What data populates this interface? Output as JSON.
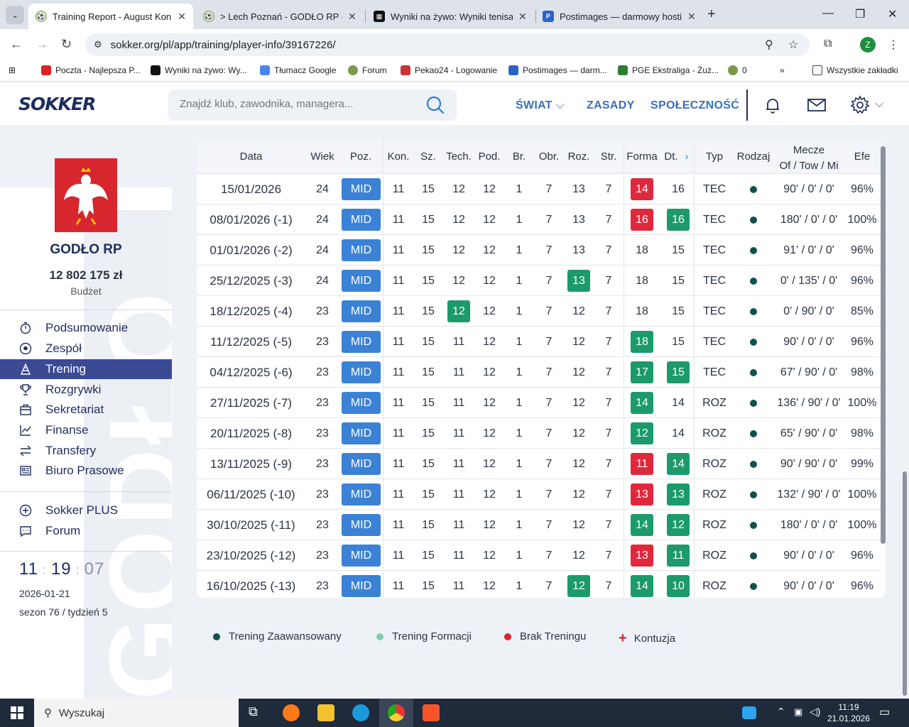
{
  "browser": {
    "tabs": [
      {
        "title": "Training Report - August Konkie",
        "active": true
      },
      {
        "title": "> Lech Poznań - GODŁO RP - S",
        "active": false
      },
      {
        "title": "Wyniki na żywo: Wyniki tenisa n",
        "active": false
      },
      {
        "title": "Postimages — darmowy hostin",
        "active": false
      }
    ],
    "url": "sokker.org/pl/app/training/player-info/39167226/",
    "profile_initial": "Z",
    "bookmarks": [
      "Poczta - Najlepsza P...",
      "Wyniki na żywo: Wy...",
      "Tłumacz Google",
      "Forum",
      "Pekao24 - Logowanie",
      "Postimages — darm...",
      "PGE Ekstraliga - Żuż...",
      "0"
    ],
    "all_bookmarks": "Wszystkie zakładki"
  },
  "header": {
    "logo": "SOKKER",
    "search_placeholder": "Znajdź klub, zawodnika, managera...",
    "nav": [
      "ŚWIAT",
      "ZASADY",
      "SPOŁECZNOŚĆ"
    ]
  },
  "sidebar": {
    "watermark": "GODŁO",
    "club_name": "GODŁO RP",
    "budget": "12 802 175 zł",
    "budget_label": "Budżet",
    "menu": [
      {
        "label": "Podsumowanie",
        "icon": "stopwatch-icon"
      },
      {
        "label": "Zespół",
        "icon": "ball-icon"
      },
      {
        "label": "Trening",
        "icon": "cone-icon"
      },
      {
        "label": "Rozgrywki",
        "icon": "trophy-icon"
      },
      {
        "label": "Sekretariat",
        "icon": "briefcase-icon"
      },
      {
        "label": "Finanse",
        "icon": "chart-icon"
      },
      {
        "label": "Transfery",
        "icon": "transfer-icon"
      },
      {
        "label": "Biuro Prasowe",
        "icon": "newspaper-icon"
      }
    ],
    "extra_menu": [
      {
        "label": "Sokker PLUS",
        "icon": "plus-circle-icon"
      },
      {
        "label": "Forum",
        "icon": "chat-icon"
      }
    ],
    "clock": {
      "h": "11",
      "m": "19",
      "s": "07"
    },
    "date": "2026-01-21",
    "season": "sezon 76 / tydzień 5"
  },
  "table": {
    "headers": {
      "date": "Data",
      "age": "Wiek",
      "pos": "Poz.",
      "kon": "Kon.",
      "sz": "Sz.",
      "tech": "Tech.",
      "pod": "Pod.",
      "br": "Br.",
      "obr": "Obr.",
      "roz": "Roz.",
      "str": "Str.",
      "forma": "Forma",
      "dt": "Dt.",
      "typ": "Typ",
      "rodzaj": "Rodzaj",
      "mecze_1": "Mecze",
      "mecze_2": "Of / Tow / Mi",
      "efe": "Efe"
    },
    "rows": [
      {
        "date": "15/01/2026",
        "age": "24",
        "pos": "MID",
        "kon": "11",
        "sz": "15",
        "tech": "12",
        "pod": "12",
        "br": "1",
        "obr": "7",
        "roz": "13",
        "str": "7",
        "forma": "14",
        "dt": "16",
        "typ": "TEC",
        "mecze": "90' / 0' / 0'",
        "efe": "96%",
        "hl": {
          "forma": "down"
        }
      },
      {
        "date": "08/01/2026 (-1)",
        "age": "24",
        "pos": "MID",
        "kon": "11",
        "sz": "15",
        "tech": "12",
        "pod": "12",
        "br": "1",
        "obr": "7",
        "roz": "13",
        "str": "7",
        "forma": "16",
        "dt": "16",
        "typ": "TEC",
        "mecze": "180' / 0' / 0'",
        "efe": "100%",
        "hl": {
          "forma": "down",
          "dt": "up"
        }
      },
      {
        "date": "01/01/2026 (-2)",
        "age": "24",
        "pos": "MID",
        "kon": "11",
        "sz": "15",
        "tech": "12",
        "pod": "12",
        "br": "1",
        "obr": "7",
        "roz": "13",
        "str": "7",
        "forma": "18",
        "dt": "15",
        "typ": "TEC",
        "mecze": "91' / 0' / 0'",
        "efe": "96%",
        "hl": {}
      },
      {
        "date": "25/12/2025 (-3)",
        "age": "24",
        "pos": "MID",
        "kon": "11",
        "sz": "15",
        "tech": "12",
        "pod": "12",
        "br": "1",
        "obr": "7",
        "roz": "13",
        "str": "7",
        "forma": "18",
        "dt": "15",
        "typ": "TEC",
        "mecze": "0' / 135' / 0'",
        "efe": "96%",
        "hl": {
          "roz": "up"
        }
      },
      {
        "date": "18/12/2025 (-4)",
        "age": "23",
        "pos": "MID",
        "kon": "11",
        "sz": "15",
        "tech": "12",
        "pod": "12",
        "br": "1",
        "obr": "7",
        "roz": "12",
        "str": "7",
        "forma": "18",
        "dt": "15",
        "typ": "TEC",
        "mecze": "0' / 90' / 0'",
        "efe": "85%",
        "hl": {
          "tech": "up"
        }
      },
      {
        "date": "11/12/2025 (-5)",
        "age": "23",
        "pos": "MID",
        "kon": "11",
        "sz": "15",
        "tech": "11",
        "pod": "12",
        "br": "1",
        "obr": "7",
        "roz": "12",
        "str": "7",
        "forma": "18",
        "dt": "15",
        "typ": "TEC",
        "mecze": "90' / 0' / 0'",
        "efe": "96%",
        "hl": {
          "forma": "up"
        }
      },
      {
        "date": "04/12/2025 (-6)",
        "age": "23",
        "pos": "MID",
        "kon": "11",
        "sz": "15",
        "tech": "11",
        "pod": "12",
        "br": "1",
        "obr": "7",
        "roz": "12",
        "str": "7",
        "forma": "17",
        "dt": "15",
        "typ": "TEC",
        "mecze": "67' / 90' / 0'",
        "efe": "98%",
        "hl": {
          "forma": "up",
          "dt": "up"
        }
      },
      {
        "date": "27/11/2025 (-7)",
        "age": "23",
        "pos": "MID",
        "kon": "11",
        "sz": "15",
        "tech": "11",
        "pod": "12",
        "br": "1",
        "obr": "7",
        "roz": "12",
        "str": "7",
        "forma": "14",
        "dt": "14",
        "typ": "ROZ",
        "mecze": "136' / 90' / 0'",
        "efe": "100%",
        "hl": {
          "forma": "up"
        }
      },
      {
        "date": "20/11/2025 (-8)",
        "age": "23",
        "pos": "MID",
        "kon": "11",
        "sz": "15",
        "tech": "11",
        "pod": "12",
        "br": "1",
        "obr": "7",
        "roz": "12",
        "str": "7",
        "forma": "12",
        "dt": "14",
        "typ": "ROZ",
        "mecze": "65' / 90' / 0'",
        "efe": "98%",
        "hl": {
          "forma": "up"
        }
      },
      {
        "date": "13/11/2025 (-9)",
        "age": "23",
        "pos": "MID",
        "kon": "11",
        "sz": "15",
        "tech": "11",
        "pod": "12",
        "br": "1",
        "obr": "7",
        "roz": "12",
        "str": "7",
        "forma": "11",
        "dt": "14",
        "typ": "ROZ",
        "mecze": "90' / 90' / 0'",
        "efe": "99%",
        "hl": {
          "forma": "down",
          "dt": "up"
        }
      },
      {
        "date": "06/11/2025 (-10)",
        "age": "23",
        "pos": "MID",
        "kon": "11",
        "sz": "15",
        "tech": "11",
        "pod": "12",
        "br": "1",
        "obr": "7",
        "roz": "12",
        "str": "7",
        "forma": "13",
        "dt": "13",
        "typ": "ROZ",
        "mecze": "132' / 90' / 0'",
        "efe": "100%",
        "hl": {
          "forma": "down",
          "dt": "up"
        }
      },
      {
        "date": "30/10/2025 (-11)",
        "age": "23",
        "pos": "MID",
        "kon": "11",
        "sz": "15",
        "tech": "11",
        "pod": "12",
        "br": "1",
        "obr": "7",
        "roz": "12",
        "str": "7",
        "forma": "14",
        "dt": "12",
        "typ": "ROZ",
        "mecze": "180' / 0' / 0'",
        "efe": "100%",
        "hl": {
          "forma": "up",
          "dt": "up"
        }
      },
      {
        "date": "23/10/2025 (-12)",
        "age": "23",
        "pos": "MID",
        "kon": "11",
        "sz": "15",
        "tech": "11",
        "pod": "12",
        "br": "1",
        "obr": "7",
        "roz": "12",
        "str": "7",
        "forma": "13",
        "dt": "11",
        "typ": "ROZ",
        "mecze": "90' / 0' / 0'",
        "efe": "96%",
        "hl": {
          "forma": "down",
          "dt": "up"
        }
      },
      {
        "date": "16/10/2025 (-13)",
        "age": "23",
        "pos": "MID",
        "kon": "11",
        "sz": "15",
        "tech": "11",
        "pod": "12",
        "br": "1",
        "obr": "7",
        "roz": "12",
        "str": "7",
        "forma": "14",
        "dt": "10",
        "typ": "ROZ",
        "mecze": "90' / 0' / 0'",
        "efe": "96%",
        "hl": {
          "roz": "up",
          "forma": "up",
          "dt": "up"
        }
      }
    ]
  },
  "legend": [
    {
      "label": "Trening Zaawansowany",
      "color": "#12504f"
    },
    {
      "label": "Trening Formacji",
      "color": "#7dd0a8"
    },
    {
      "label": "Brak Treningu",
      "color": "#d7262d"
    },
    {
      "label": "Kontuzja",
      "color": "#d7262d"
    }
  ],
  "taskbar": {
    "search": "Wyszukaj",
    "time": "11:19",
    "date": "21.01.2026"
  },
  "colors": {
    "up": "#1c9a6c",
    "down": "#e0283d",
    "pos": "#3b82d6",
    "nav": "#3b6fb6",
    "active_menu": "#3a4a95"
  }
}
